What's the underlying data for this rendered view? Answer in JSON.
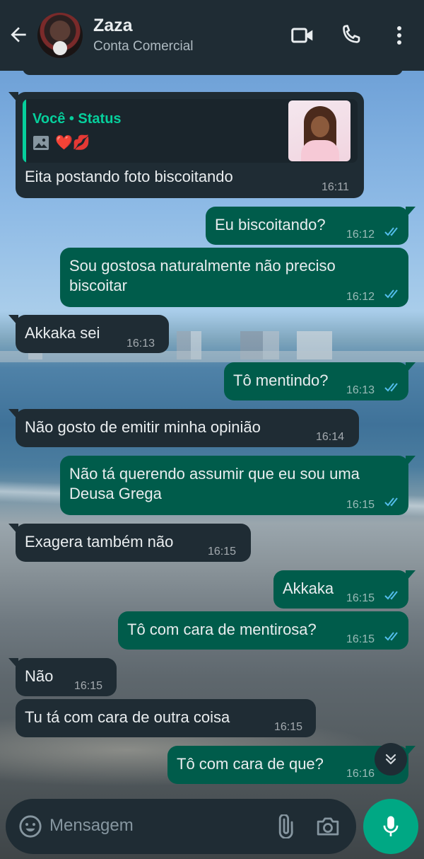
{
  "header": {
    "name": "Zaza",
    "subtitle": "Conta Comercial",
    "icons": [
      "back-arrow-icon",
      "video-call-icon",
      "voice-call-icon",
      "more-options-icon"
    ]
  },
  "status_quote": {
    "title": "Você • Status",
    "emojis": "❤️💋"
  },
  "messages": [
    {
      "dir": "in",
      "text": "Eita postando foto biscoitando",
      "time": "16:11"
    },
    {
      "dir": "out",
      "text": "Eu biscoitando?",
      "time": "16:12"
    },
    {
      "dir": "out",
      "text": "Sou gostosa naturalmente não preciso biscoitar",
      "time": "16:12"
    },
    {
      "dir": "in",
      "text": "Akkaka sei",
      "time": "16:13"
    },
    {
      "dir": "out",
      "text": "Tô mentindo?",
      "time": "16:13"
    },
    {
      "dir": "in",
      "text": "Não gosto de emitir minha opinião",
      "time": "16:14"
    },
    {
      "dir": "out",
      "text": "Não tá querendo assumir que eu sou uma Deusa Grega",
      "time": "16:15"
    },
    {
      "dir": "in",
      "text": "Exagera também não",
      "time": "16:15"
    },
    {
      "dir": "out",
      "text": "Akkaka",
      "time": "16:15"
    },
    {
      "dir": "out",
      "text": "Tô com cara de mentirosa?",
      "time": "16:15"
    },
    {
      "dir": "in",
      "text": "Não",
      "time": "16:15"
    },
    {
      "dir": "in",
      "text": "Tu tá com cara de outra coisa",
      "time": "16:15"
    },
    {
      "dir": "out",
      "text": "Tô com cara de que?",
      "time": "16:16"
    }
  ],
  "composer": {
    "placeholder": "Mensagem"
  },
  "colors": {
    "header": "#1f2c34",
    "incoming": "#1f2c34",
    "outgoing": "#005c4b",
    "accent": "#00a884",
    "read_ticks": "#53bdeb"
  }
}
